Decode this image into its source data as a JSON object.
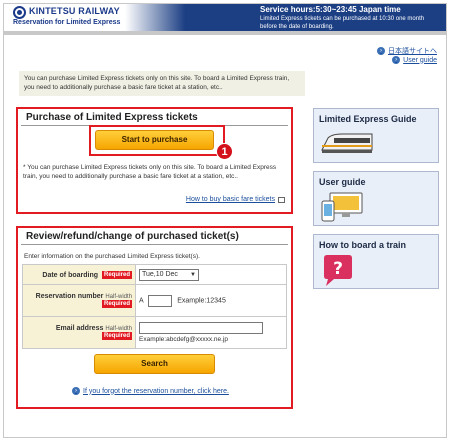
{
  "header": {
    "brand_name": "KINTETSU RAILWAY",
    "brand_sub": "Reservation for Limited Express",
    "service_hours": "Service hours:5:30~23:45 Japan time",
    "service_note": "Limited Express tickets can be purchased at 10:30 one month before the date of boarding."
  },
  "top_links": {
    "japanese_site": "日本語サイトへ",
    "user_guide": "User guide"
  },
  "notice": "You can purchase Limited Express tickets only on this site. To board a Limited Express train, you need to additionally purchase a basic fare ticket at a station, etc..",
  "purchase": {
    "title": "Purchase of Limited Express tickets",
    "start_button": "Start to purchase",
    "step_badge": "1",
    "note": "* You can purchase Limited Express tickets only on this site. To board a Limited Express train, you need to additionally purchase a basic fare ticket at a station, etc..",
    "basic_fare_link": "How to buy basic fare tickets"
  },
  "review": {
    "title": "Review/refund/change of purchased ticket(s)",
    "instruction": "Enter information on the purchased Limited Express ticket(s).",
    "date_label": "Date of boarding",
    "date_value": "Tue,10 Dec",
    "reservation_label": "Reservation number",
    "reservation_hint": "Half-width",
    "reservation_prefix": "A",
    "reservation_value": "",
    "reservation_example": "Example:12345",
    "email_label": "Email address",
    "email_hint": "Half-width",
    "email_value": "",
    "email_example": "Example:abcdefg@xxxxx.ne.jp",
    "required_tag": "Required",
    "search_button": "Search",
    "forgot_link": "If you forgot the reservation number, click here."
  },
  "side_cards": [
    {
      "title": "Limited Express Guide",
      "icon": "train-icon"
    },
    {
      "title": "User guide",
      "icon": "guide-devices-icon"
    },
    {
      "title": "How to board a train",
      "icon": "question-bubble-icon"
    }
  ],
  "colors": {
    "brand_blue": "#1c3f84",
    "alert_red": "#e21a22",
    "button_orange": "#f6a500",
    "card_bg": "#e9eff8"
  }
}
